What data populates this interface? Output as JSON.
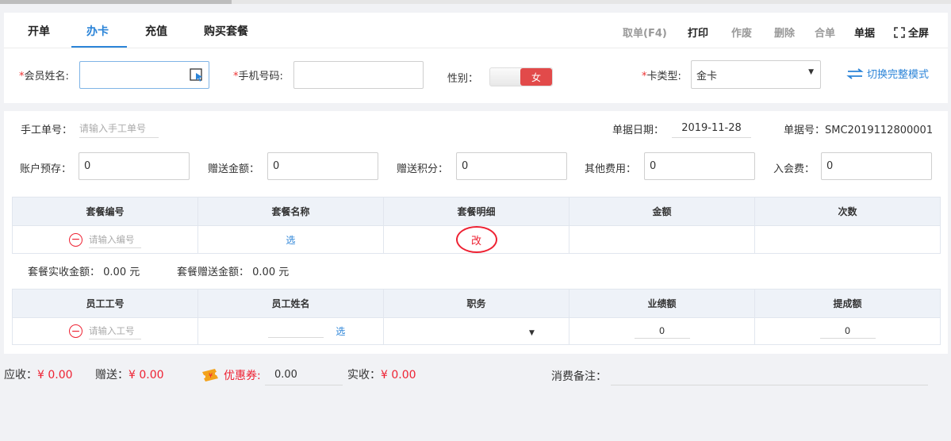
{
  "tabs": [
    "开单",
    "办卡",
    "充值",
    "购买套餐"
  ],
  "toolbar": {
    "fetch": "取单(F4)",
    "print": "打印",
    "void": "作废",
    "delete": "删除",
    "merge": "合单",
    "receipt": "单据",
    "fullscreen": "全屏"
  },
  "form": {
    "member_name_label": "会员姓名:",
    "phone_label": "手机号码:",
    "gender_label": "性别：",
    "gender_value": "女",
    "card_type_label": "卡类型:",
    "card_type_value": "金卡",
    "switch_mode": "切换完整模式",
    "required_mark": "*"
  },
  "doc": {
    "manual_no_label": "手工单号：",
    "manual_no_placeholder": "请输入手工单号",
    "date_label": "单据日期：",
    "date_value": "2019-11-28",
    "doc_no_label": "单据号：",
    "doc_no_value": "SMC2019112800001"
  },
  "amounts": [
    {
      "label": "账户预存：",
      "value": "0"
    },
    {
      "label": "赠送金额：",
      "value": "0"
    },
    {
      "label": "赠送积分：",
      "value": "0"
    },
    {
      "label": "其他费用：",
      "value": "0"
    },
    {
      "label": "入会费：",
      "value": "0"
    }
  ],
  "package_table": {
    "headers": [
      "套餐编号",
      "套餐名称",
      "套餐明细",
      "金额",
      "次数"
    ],
    "code_placeholder": "请输入编号",
    "select_label": "选",
    "edit_label": "改"
  },
  "package_summary": {
    "actual_label": "套餐实收金额：",
    "actual_value": "0.00 元",
    "gift_label": "套餐赠送金额：",
    "gift_value": "0.00 元"
  },
  "staff_table": {
    "headers": [
      "员工工号",
      "员工姓名",
      "职务",
      "业绩额",
      "提成额"
    ],
    "id_placeholder": "请输入工号",
    "select_label": "选",
    "performance": "0",
    "commission": "0"
  },
  "footer": {
    "receivable_label": "应收：",
    "receivable_value": "¥ 0.00",
    "gift_label": "赠送：",
    "gift_value": "¥ 0.00",
    "coupon_label": "优惠券:",
    "coupon_value": "0.00",
    "actual_label": "实收：",
    "actual_value": "¥ 0.00",
    "remark_label": "消费备注："
  },
  "colors": {
    "accent": "#2b84d8",
    "danger": "#e23"
  }
}
